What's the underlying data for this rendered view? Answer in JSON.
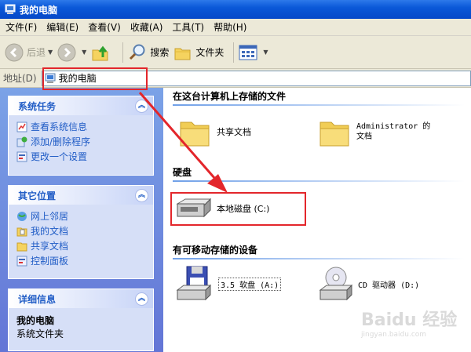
{
  "window": {
    "title": "我的电脑"
  },
  "menu": [
    {
      "label": "文件(F)"
    },
    {
      "label": "编辑(E)"
    },
    {
      "label": "查看(V)"
    },
    {
      "label": "收藏(A)"
    },
    {
      "label": "工具(T)"
    },
    {
      "label": "帮助(H)"
    }
  ],
  "toolbar": {
    "back_label": "后退",
    "search_label": "搜索",
    "folders_label": "文件夹"
  },
  "address": {
    "label": "地址(D)",
    "value": "我的电脑"
  },
  "system_tasks": {
    "title": "系统任务",
    "items": [
      {
        "label": "查看系统信息"
      },
      {
        "label": "添加/删除程序"
      },
      {
        "label": "更改一个设置"
      }
    ]
  },
  "other_places": {
    "title": "其它位置",
    "items": [
      {
        "label": "网上邻居"
      },
      {
        "label": "我的文档"
      },
      {
        "label": "共享文档"
      },
      {
        "label": "控制面板"
      }
    ]
  },
  "details": {
    "title": "详细信息",
    "name": "我的电脑",
    "type": "系统文件夹"
  },
  "groups": {
    "files": {
      "title": "在这台计算机上存储的文件",
      "items": [
        {
          "label": "共享文档"
        },
        {
          "label": "Administrator 的文档"
        }
      ]
    },
    "disks": {
      "title": "硬盘",
      "items": [
        {
          "label": "本地磁盘 (C:)"
        }
      ]
    },
    "removable": {
      "title": "有可移动存储的设备",
      "items": [
        {
          "label": "3.5 软盘 (A:)"
        },
        {
          "label": "CD 驱动器 (D:)"
        }
      ]
    }
  },
  "watermark": {
    "main": "Baidu 经验",
    "sub": "jingyan.baidu.com"
  },
  "colors": {
    "annotation": "#e3262b",
    "task_link": "#215dc6",
    "title_bar": "#0a58d8"
  }
}
